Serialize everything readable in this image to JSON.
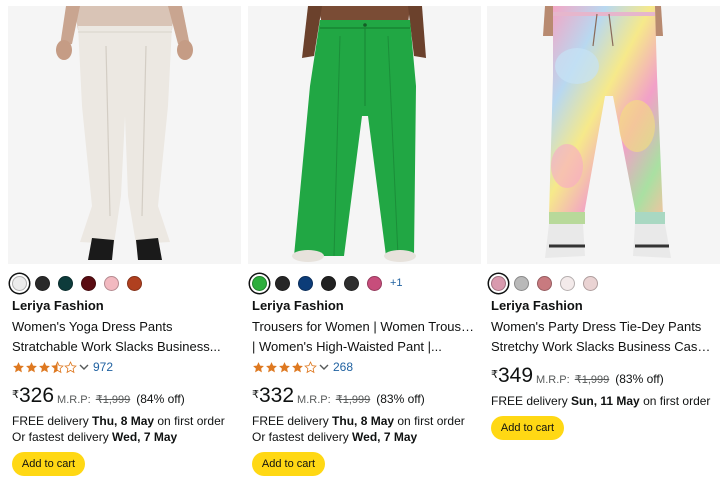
{
  "products": [
    {
      "brand": "Leriya Fashion",
      "title_line1": "Women's Yoga Dress Pants",
      "title_line2": "Stratchable Work Slacks Business...",
      "swatches": [
        "#ececec",
        "#2a2a2a",
        "#0d3b3b",
        "#5a0c12",
        "#f2b9c0",
        "#b0401f"
      ],
      "rating": 3.5,
      "rating_count": "972",
      "currency": "₹",
      "price": "326",
      "mrp_label": "M.R.P:",
      "mrp": "₹1,999",
      "discount": "(84% off)",
      "delivery_prefix": "FREE delivery ",
      "delivery_date": "Thu, 8 May",
      "delivery_suffix": " on first order",
      "fast_prefix": "Or fastest delivery ",
      "fast_date": "Wed, 7 May",
      "add_to_cart": "Add to cart"
    },
    {
      "brand": "Leriya Fashion",
      "title_line1": "Trousers for Women | Women Trousers",
      "title_line2": "| Women's High-Waisted Pant |...",
      "swatches": [
        "#2cae3c",
        "#262626",
        "#0c3c78",
        "#222222",
        "#2e2e2e",
        "#c74d7b"
      ],
      "more_colors": "+1",
      "rating": 4,
      "rating_count": "268",
      "currency": "₹",
      "price": "332",
      "mrp_label": "M.R.P:",
      "mrp": "₹1,999",
      "discount": "(83% off)",
      "delivery_prefix": "FREE delivery ",
      "delivery_date": "Thu, 8 May",
      "delivery_suffix": " on first order",
      "fast_prefix": "Or fastest delivery ",
      "fast_date": "Wed, 7 May",
      "add_to_cart": "Add to cart"
    },
    {
      "brand": "Leriya Fashion",
      "title_line1": "Women's Party Dress Tie-Dey Pants",
      "title_line2": "Stretchy Work Slacks Business Casua...",
      "swatches": [
        "#d99aae",
        "#b9b9b9",
        "#c87a7f",
        "#f3eaea",
        "#ead3d3"
      ],
      "currency": "₹",
      "price": "349",
      "mrp_label": "M.R.P:",
      "mrp": "₹1,999",
      "discount": "(83% off)",
      "delivery_prefix": "FREE delivery ",
      "delivery_date": "Sun, 11 May",
      "delivery_suffix": " on first order",
      "add_to_cart": "Add to cart"
    }
  ],
  "colors": {
    "star": "#de7921",
    "link": "#2162a1",
    "button": "#ffd814"
  }
}
